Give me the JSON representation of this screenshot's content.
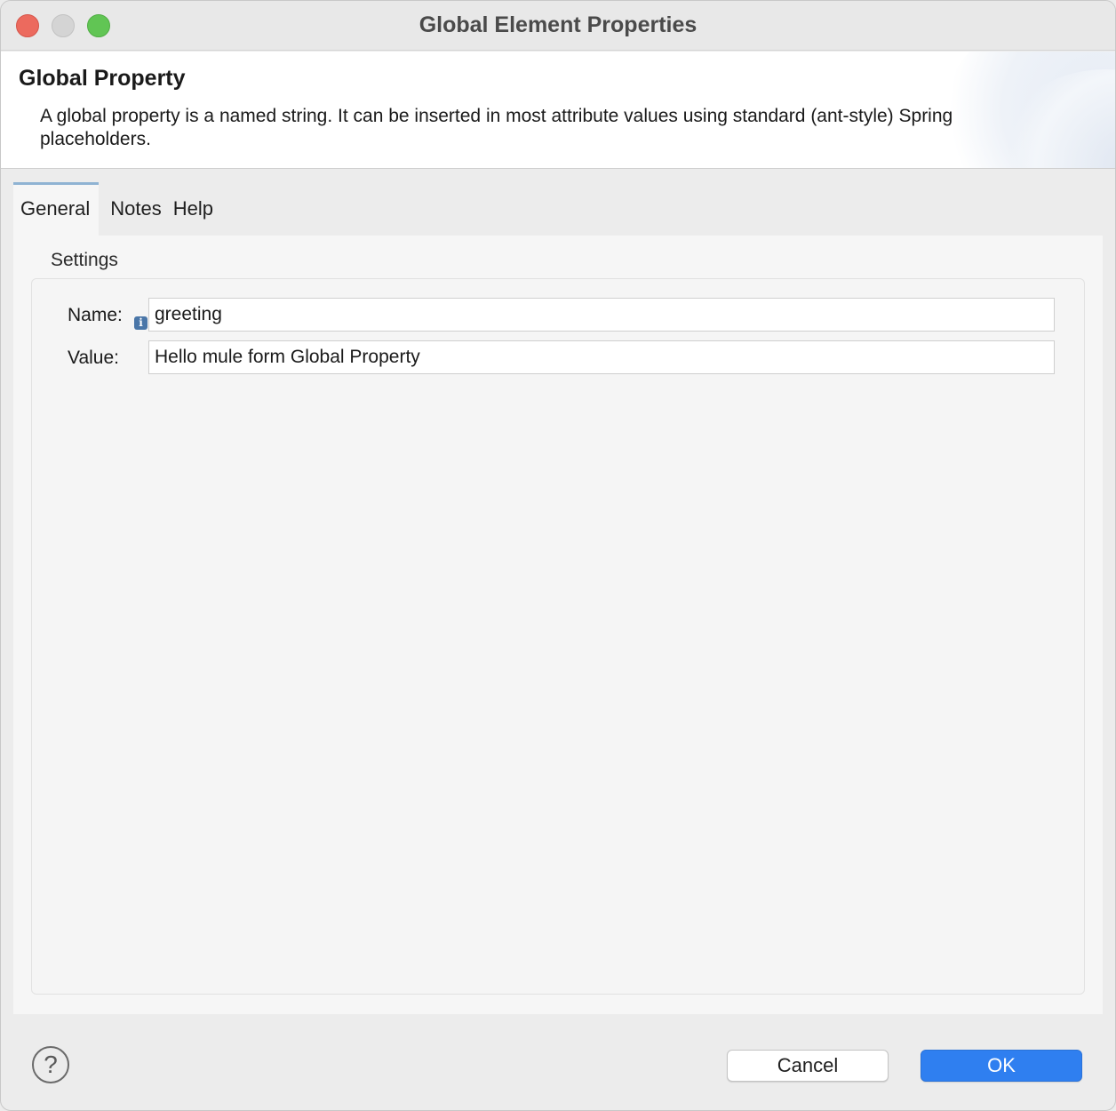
{
  "window": {
    "title": "Global Element Properties"
  },
  "banner": {
    "title": "Global Property",
    "description": "A global property is a named string. It can be inserted in most attribute values using standard (ant-style) Spring placeholders."
  },
  "tabs": [
    {
      "label": "General",
      "active": true
    },
    {
      "label": "Notes",
      "active": false
    },
    {
      "label": "Help",
      "active": false
    }
  ],
  "settings": {
    "section_label": "Settings",
    "name": {
      "label": "Name:",
      "value": "greeting",
      "info_icon": "info-icon"
    },
    "value": {
      "label": "Value:",
      "value": "Hello mule form Global Property"
    }
  },
  "footer": {
    "help_glyph": "?",
    "cancel_label": "Cancel",
    "ok_label": "OK"
  },
  "colors": {
    "accent": "#2f7ff0",
    "close": "#ec6a5e",
    "zoom": "#61c554",
    "active_tab_border": "#8fb3d3"
  }
}
